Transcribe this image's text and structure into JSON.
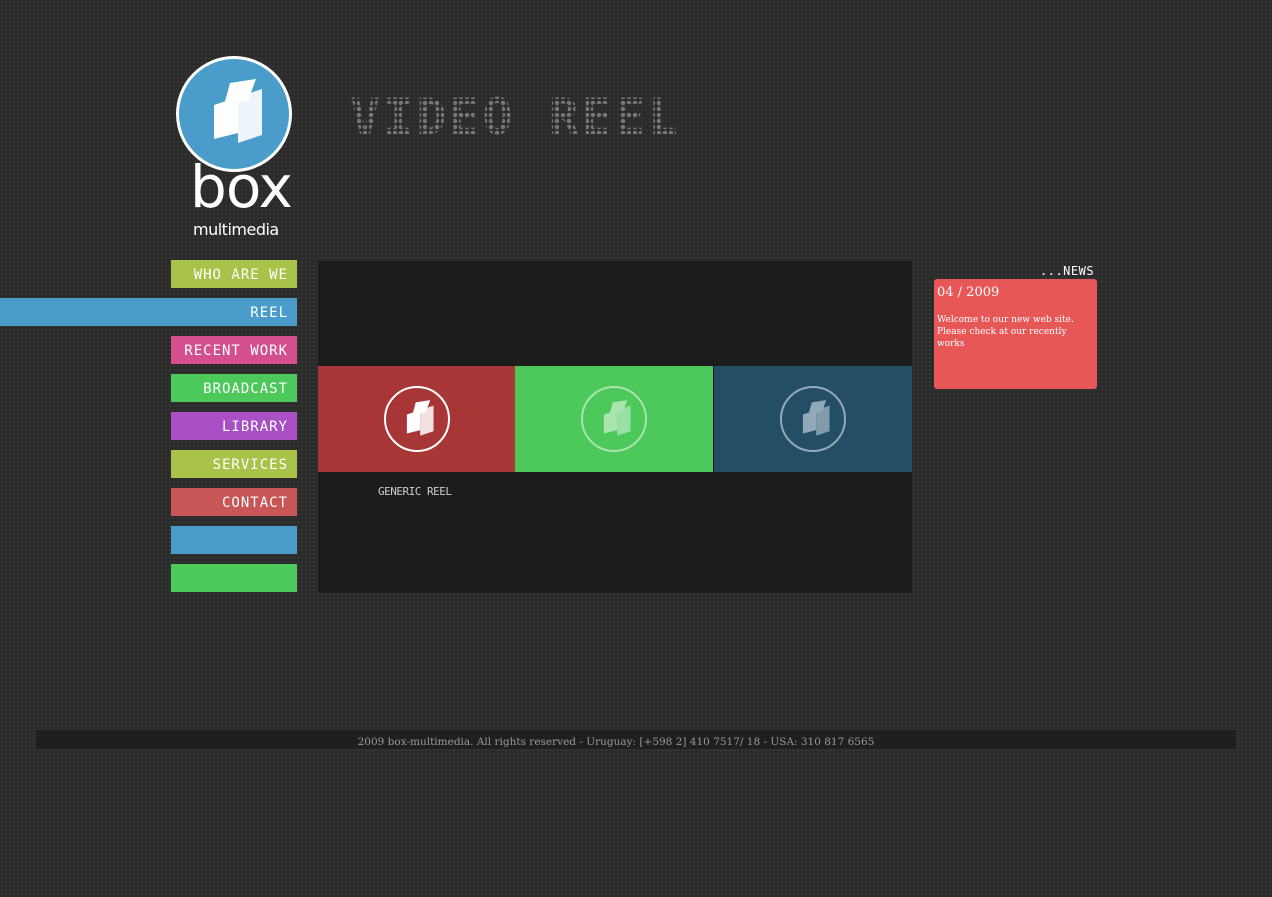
{
  "logo": {
    "word": "box",
    "sub": "multimedia"
  },
  "page_title": "VIDEO REEL",
  "nav": [
    {
      "label": "WHO ARE WE",
      "color": "#a9c24a"
    },
    {
      "label": "REEL",
      "color": "#4a9ccb",
      "active": true
    },
    {
      "label": "RECENT WORK",
      "color": "#d44f8d"
    },
    {
      "label": "BROADCAST",
      "color": "#4dc95c"
    },
    {
      "label": "LIBRARY",
      "color": "#a950c4"
    },
    {
      "label": "SERVICES",
      "color": "#a9c24a"
    },
    {
      "label": "CONTACT",
      "color": "#c85656"
    },
    {
      "label": "",
      "color": "#4a9ccb"
    },
    {
      "label": "",
      "color": "#4dc95c"
    }
  ],
  "tiles": [
    {
      "color": "#a93636",
      "icon_color": "#ffffff"
    },
    {
      "color": "#4dc95c",
      "icon_color": "#a8e4ae"
    },
    {
      "color": "#234e66",
      "icon_color": "#93a9b8"
    }
  ],
  "reel_label": "GENERIC REEL",
  "news": {
    "title": "...NEWS",
    "date": "04 / 2009",
    "text": "Welcome to our new web site. Please check at our recently works"
  },
  "footer": {
    "text": "2009 box-multimedia. All rights reserved - Uruguay: [+598 2] 410 7517/ 18  -  USA: 310 817 6565"
  }
}
